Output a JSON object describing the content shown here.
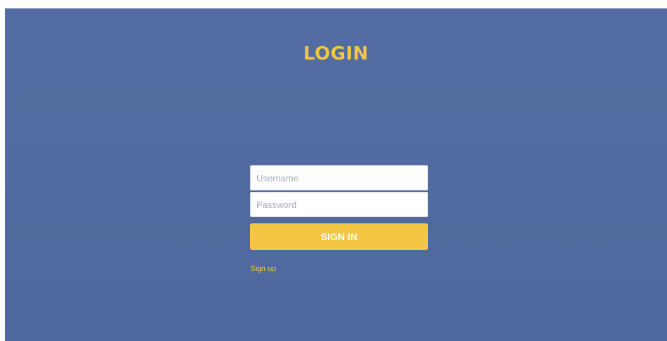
{
  "login": {
    "title": "LOGIN",
    "username_placeholder": "Username",
    "password_placeholder": "Password",
    "signin_label": "SIGN IN",
    "signup_label": "Sign up"
  },
  "colors": {
    "background": "#506aa0",
    "accent": "#f3c744",
    "input_background": "#ffffff"
  }
}
